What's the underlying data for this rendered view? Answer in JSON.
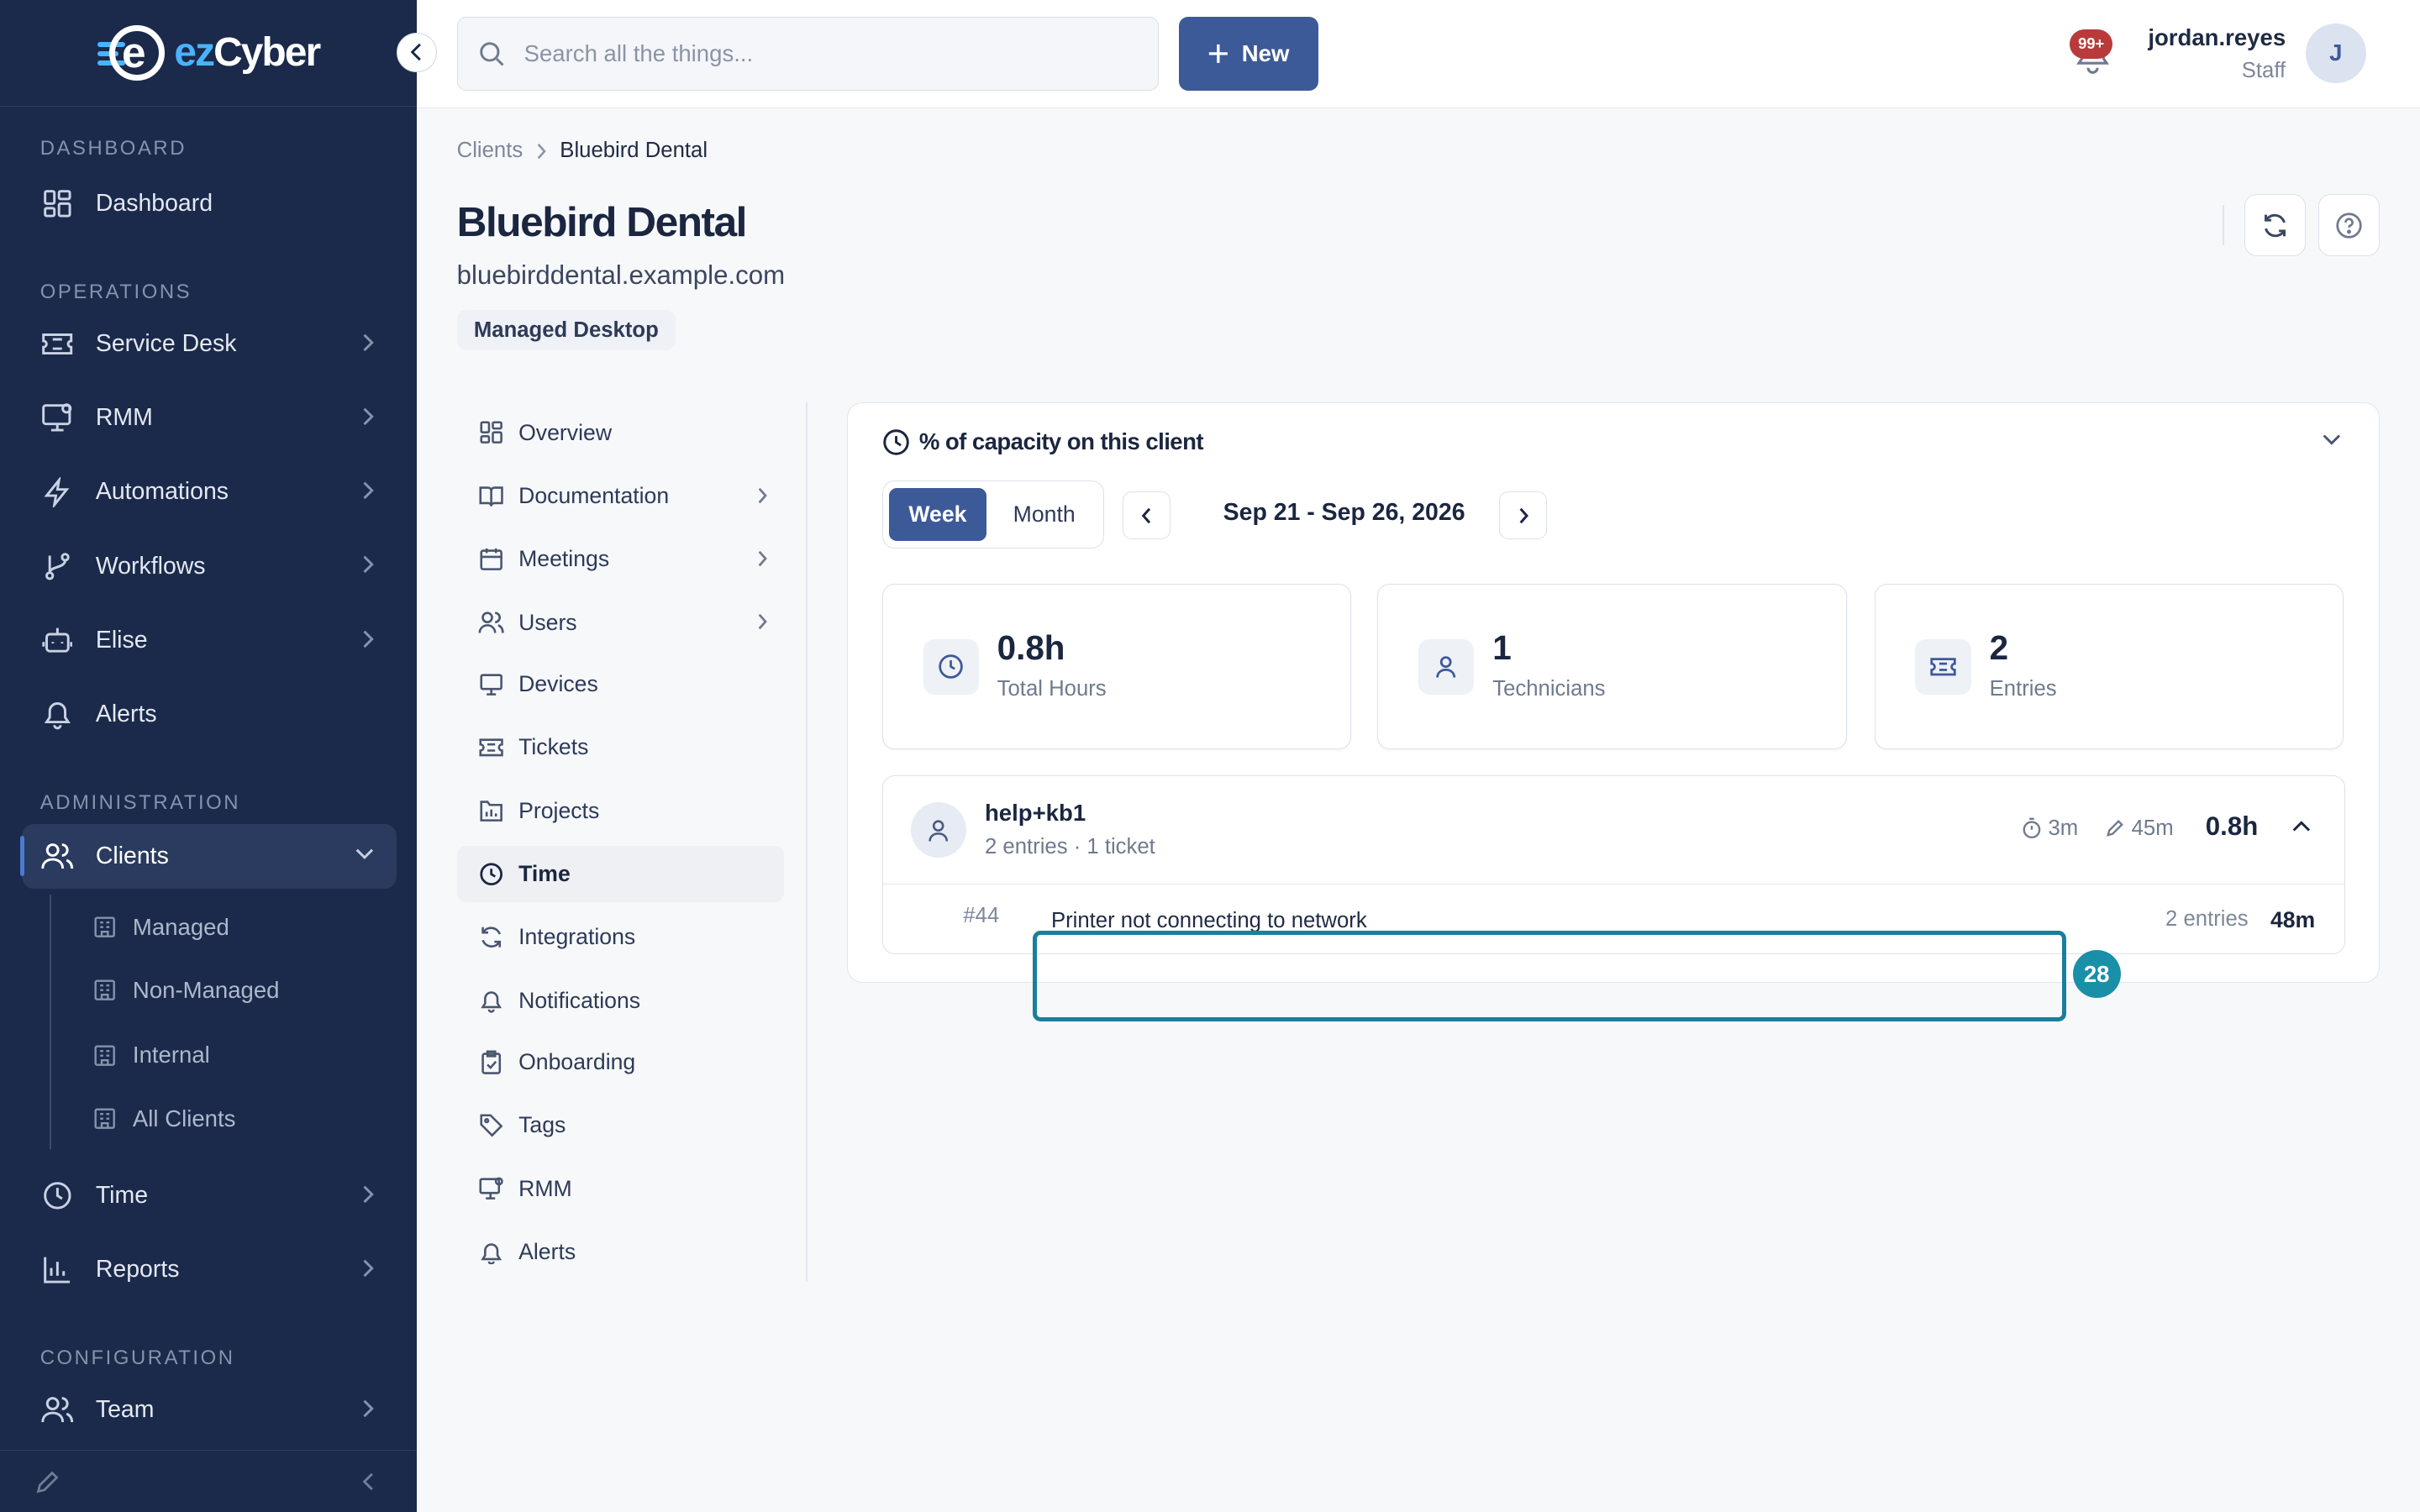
{
  "brand": {
    "name_prefix": "ez",
    "name_suffix": "Cyber"
  },
  "colors": {
    "sidebar_bg": "#1b2a4a",
    "accent": "#3d5a98",
    "logo_blue": "#4ab3ff",
    "badge_red": "#b83a3a",
    "highlight": "#1a7f9b"
  },
  "sidebar": {
    "sections": {
      "dashboard": "DASHBOARD",
      "operations": "OPERATIONS",
      "administration": "ADMINISTRATION",
      "configuration": "CONFIGURATION"
    },
    "items": {
      "dashboard": "Dashboard",
      "service_desk": "Service Desk",
      "rmm": "RMM",
      "automations": "Automations",
      "workflows": "Workflows",
      "elise": "Elise",
      "alerts": "Alerts",
      "clients": "Clients",
      "time": "Time",
      "reports": "Reports",
      "team": "Team"
    },
    "clients_sub": [
      "Managed",
      "Non-Managed",
      "Internal",
      "All Clients"
    ]
  },
  "topbar": {
    "search_placeholder": "Search all the things...",
    "new_label": "New",
    "notifications_badge": "99+",
    "user_name": "jordan.reyes",
    "user_role": "Staff",
    "avatar_initial": "J"
  },
  "page": {
    "breadcrumb": [
      "Clients",
      "Bluebird Dental"
    ],
    "title": "Bluebird Dental",
    "domain": "bluebirddental.example.com",
    "tag": "Managed Desktop"
  },
  "subnav": [
    "Overview",
    "Documentation",
    "Meetings",
    "Users",
    "Devices",
    "Tickets",
    "Projects",
    "Time",
    "Integrations",
    "Notifications",
    "Onboarding",
    "Tags",
    "RMM",
    "Alerts"
  ],
  "capacity": {
    "title": "% of capacity on this client",
    "period_options": [
      "Week",
      "Month"
    ],
    "selected_period": "Week",
    "date_range": "Sep 21 - Sep 26, 2026",
    "stats": [
      {
        "value": "0.8h",
        "label": "Total Hours",
        "icon": "clock-icon"
      },
      {
        "value": "1",
        "label": "Technicians",
        "icon": "user-icon"
      },
      {
        "value": "2",
        "label": "Entries",
        "icon": "ticket-icon"
      }
    ],
    "technician": {
      "name": "help+kb1",
      "summary": "2 entries · 1 ticket",
      "timer": "3m",
      "manual": "45m",
      "total": "0.8h",
      "entries": [
        {
          "id": "#44",
          "title": "Printer not connecting to network",
          "count": "2 entries",
          "time": "48m"
        }
      ]
    }
  },
  "annotation": {
    "marker": "28"
  }
}
